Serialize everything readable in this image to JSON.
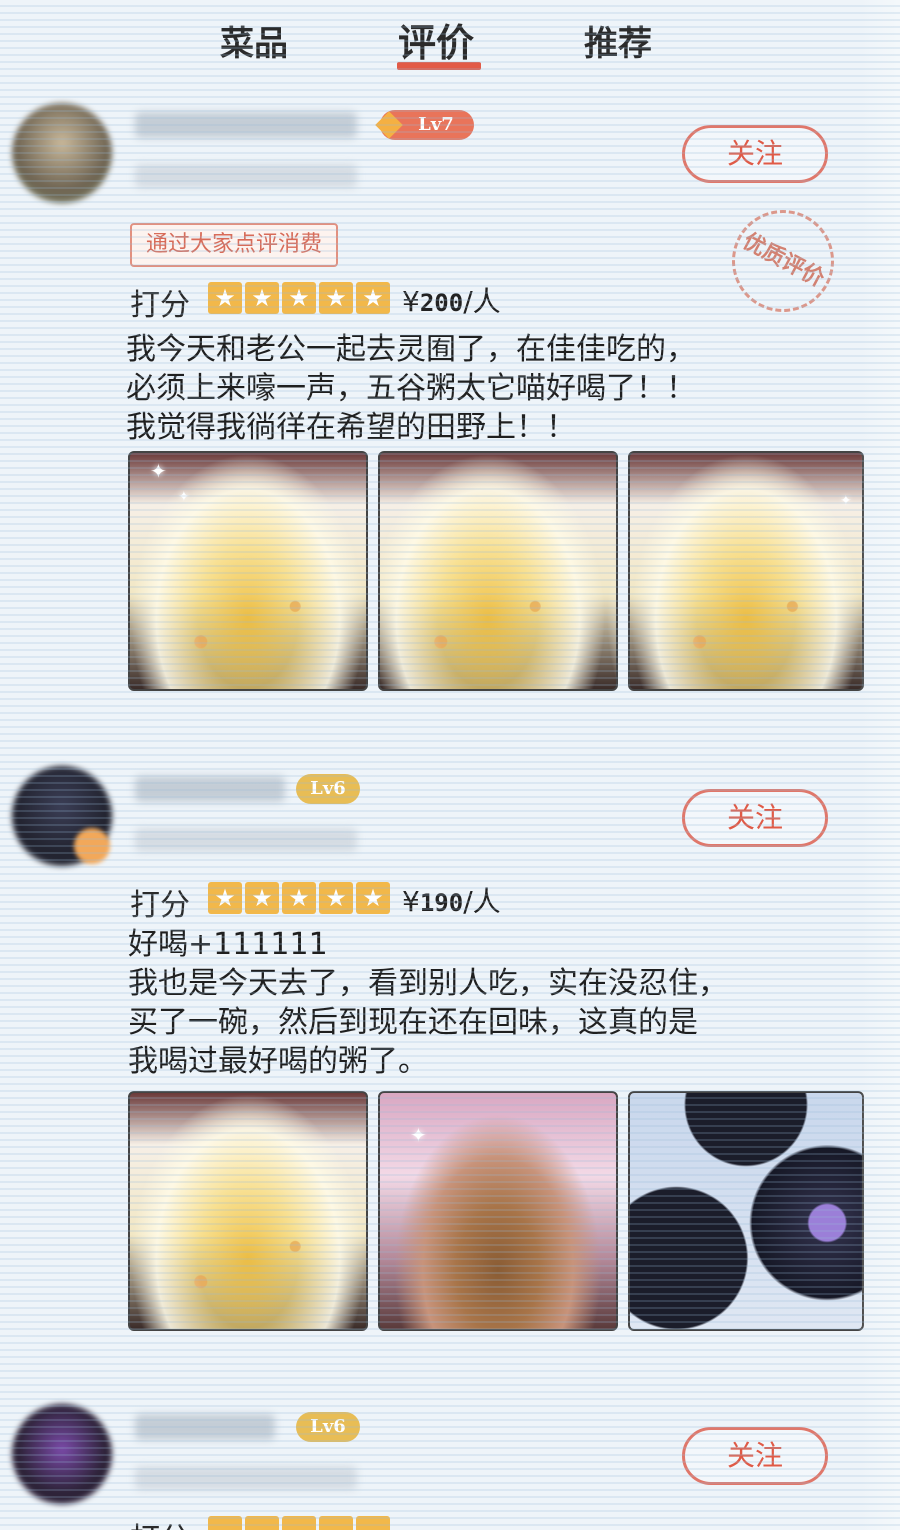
{
  "tabs": [
    {
      "label": "菜品"
    },
    {
      "label": "评价",
      "active": true
    },
    {
      "label": "推荐"
    }
  ],
  "reviews": [
    {
      "level": "Lv7",
      "follow_label": "关注",
      "tag": "通过大家点评消费",
      "stamp": "优质评价",
      "score_label": "打分",
      "stars": 5,
      "price_prefix": "¥",
      "price": "200",
      "price_suffix": "/人",
      "text": "我今天和老公一起去灵囿了，在佳佳吃的，\n必须上来嚎一声，五谷粥太它喵好喝了！！\n我觉得我徜徉在希望的田野上！！",
      "photos": [
        "porridge",
        "porridge",
        "porridge"
      ]
    },
    {
      "level": "Lv6",
      "follow_label": "关注",
      "score_label": "打分",
      "stars": 5,
      "price_prefix": "¥",
      "price": "190",
      "price_suffix": "/人",
      "text": "好喝+111111\n我也是今天去了，看到别人吃，实在没忍住，\n买了一碗，然后到现在还在回味，这真的是\n我喝过最好喝的粥了。",
      "photos": [
        "porridge",
        "nuts",
        "bowls"
      ]
    },
    {
      "level": "Lv6",
      "follow_label": "关注",
      "score_label": "打分"
    }
  ],
  "colors": {
    "accent": "#e25a47",
    "star": "#f2b84a",
    "lv7_badge": "#e9745a",
    "lv6_badge": "#e8bd55"
  },
  "icons": {
    "star": "star-icon",
    "diamond": "diamond-icon"
  }
}
